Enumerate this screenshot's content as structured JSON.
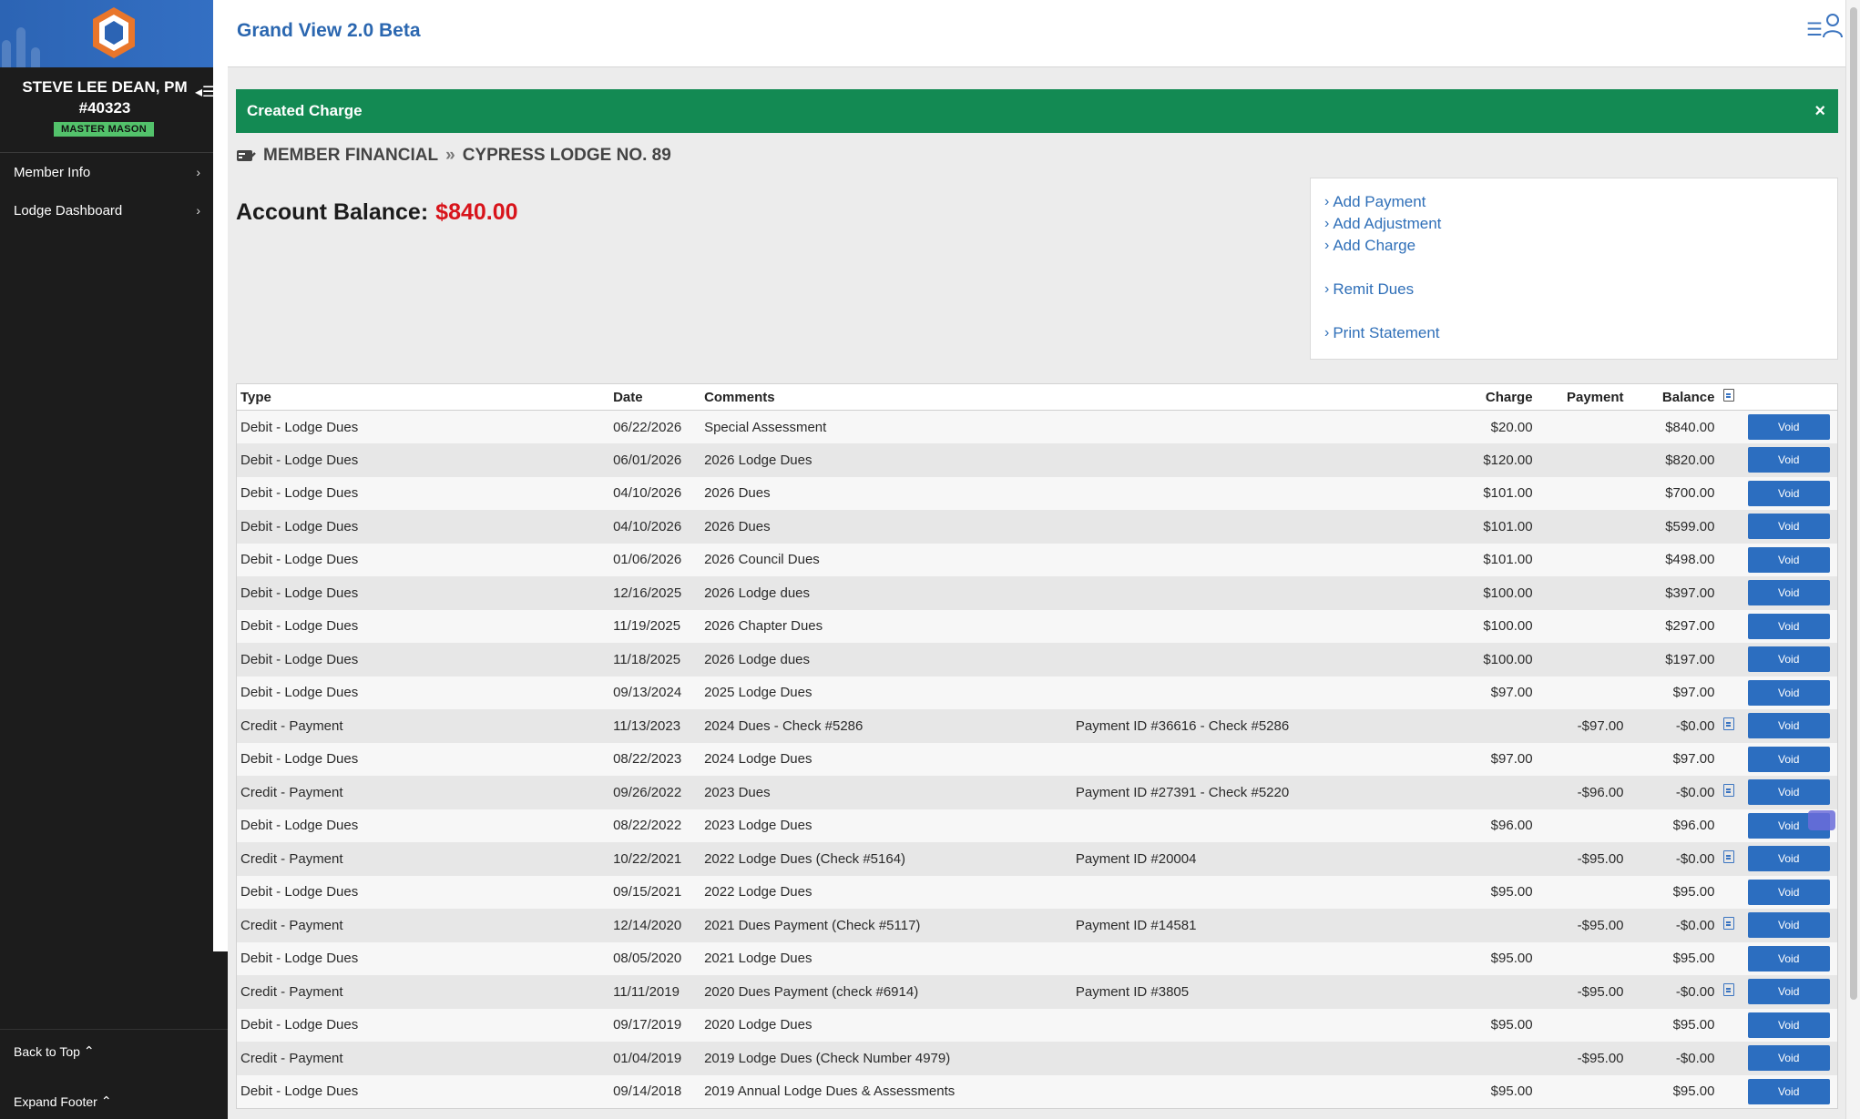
{
  "app": {
    "title": "Grand View 2.0 Beta"
  },
  "member": {
    "name": "STEVE LEE DEAN, PM",
    "number": "#40323",
    "rank": "MASTER MASON"
  },
  "sidebar": {
    "items": [
      {
        "label": "Member Info"
      },
      {
        "label": "Lodge Dashboard"
      }
    ],
    "back_to_top": "Back to Top",
    "expand_footer": "Expand Footer"
  },
  "alert": {
    "message": "Created Charge",
    "close": "×"
  },
  "breadcrumb": {
    "section": "MEMBER FINANCIAL",
    "separator": "»",
    "lodge": "CYPRESS LODGE NO. 89"
  },
  "balance": {
    "label": "Account Balance:",
    "value": "$840.00"
  },
  "actions": [
    {
      "label": "Add Payment"
    },
    {
      "label": "Add Adjustment"
    },
    {
      "label": "Add Charge"
    },
    {
      "label": "Remit Dues"
    },
    {
      "label": "Print Statement"
    }
  ],
  "table": {
    "headers": {
      "type": "Type",
      "date": "Date",
      "comments": "Comments",
      "charge": "Charge",
      "payment": "Payment",
      "balance": "Balance"
    },
    "void_label": "Void",
    "rows": [
      {
        "type": "Debit - Lodge Dues",
        "date": "06/22/2026",
        "comment": "Special Assessment",
        "note": "",
        "charge": "$20.00",
        "payment": "",
        "balance": "$840.00",
        "doc": false
      },
      {
        "type": "Debit - Lodge Dues",
        "date": "06/01/2026",
        "comment": "2026 Lodge Dues",
        "note": "",
        "charge": "$120.00",
        "payment": "",
        "balance": "$820.00",
        "doc": false
      },
      {
        "type": "Debit - Lodge Dues",
        "date": "04/10/2026",
        "comment": "2026 Dues",
        "note": "",
        "charge": "$101.00",
        "payment": "",
        "balance": "$700.00",
        "doc": false
      },
      {
        "type": "Debit - Lodge Dues",
        "date": "04/10/2026",
        "comment": "2026 Dues",
        "note": "",
        "charge": "$101.00",
        "payment": "",
        "balance": "$599.00",
        "doc": false
      },
      {
        "type": "Debit - Lodge Dues",
        "date": "01/06/2026",
        "comment": "2026 Council Dues",
        "note": "",
        "charge": "$101.00",
        "payment": "",
        "balance": "$498.00",
        "doc": false
      },
      {
        "type": "Debit - Lodge Dues",
        "date": "12/16/2025",
        "comment": "2026 Lodge dues",
        "note": "",
        "charge": "$100.00",
        "payment": "",
        "balance": "$397.00",
        "doc": false
      },
      {
        "type": "Debit - Lodge Dues",
        "date": "11/19/2025",
        "comment": "2026 Chapter Dues",
        "note": "",
        "charge": "$100.00",
        "payment": "",
        "balance": "$297.00",
        "doc": false
      },
      {
        "type": "Debit - Lodge Dues",
        "date": "11/18/2025",
        "comment": "2026 Lodge dues",
        "note": "",
        "charge": "$100.00",
        "payment": "",
        "balance": "$197.00",
        "doc": false
      },
      {
        "type": "Debit - Lodge Dues",
        "date": "09/13/2024",
        "comment": "2025 Lodge Dues",
        "note": "",
        "charge": "$97.00",
        "payment": "",
        "balance": "$97.00",
        "doc": false
      },
      {
        "type": "Credit - Payment",
        "date": "11/13/2023",
        "comment": "2024 Dues - Check #5286",
        "note": "Payment ID #36616 - Check #5286",
        "charge": "",
        "payment": "-$97.00",
        "balance": "-$0.00",
        "doc": true
      },
      {
        "type": "Debit - Lodge Dues",
        "date": "08/22/2023",
        "comment": "2024 Lodge Dues",
        "note": "",
        "charge": "$97.00",
        "payment": "",
        "balance": "$97.00",
        "doc": false
      },
      {
        "type": "Credit - Payment",
        "date": "09/26/2022",
        "comment": "2023 Dues",
        "note": "Payment ID #27391 - Check #5220",
        "charge": "",
        "payment": "-$96.00",
        "balance": "-$0.00",
        "doc": true
      },
      {
        "type": "Debit - Lodge Dues",
        "date": "08/22/2022",
        "comment": "2023 Lodge Dues",
        "note": "",
        "charge": "$96.00",
        "payment": "",
        "balance": "$96.00",
        "doc": false
      },
      {
        "type": "Credit - Payment",
        "date": "10/22/2021",
        "comment": "2022 Lodge Dues (Check #5164)",
        "note": "Payment ID #20004",
        "charge": "",
        "payment": "-$95.00",
        "balance": "-$0.00",
        "doc": true
      },
      {
        "type": "Debit - Lodge Dues",
        "date": "09/15/2021",
        "comment": "2022 Lodge Dues",
        "note": "",
        "charge": "$95.00",
        "payment": "",
        "balance": "$95.00",
        "doc": false
      },
      {
        "type": "Credit - Payment",
        "date": "12/14/2020",
        "comment": "2021 Dues Payment (Check #5117)",
        "note": "Payment ID #14581",
        "charge": "",
        "payment": "-$95.00",
        "balance": "-$0.00",
        "doc": true
      },
      {
        "type": "Debit - Lodge Dues",
        "date": "08/05/2020",
        "comment": "2021 Lodge Dues",
        "note": "",
        "charge": "$95.00",
        "payment": "",
        "balance": "$95.00",
        "doc": false
      },
      {
        "type": "Credit - Payment",
        "date": "11/11/2019",
        "comment": "2020 Dues Payment (check #6914)",
        "note": "Payment ID #3805",
        "charge": "",
        "payment": "-$95.00",
        "balance": "-$0.00",
        "doc": true
      },
      {
        "type": "Debit - Lodge Dues",
        "date": "09/17/2019",
        "comment": "2020 Lodge Dues",
        "note": "",
        "charge": "$95.00",
        "payment": "",
        "balance": "$95.00",
        "doc": false
      },
      {
        "type": "Credit - Payment",
        "date": "01/04/2019",
        "comment": "2019 Lodge Dues (Check Number 4979)",
        "note": "",
        "charge": "",
        "payment": "-$95.00",
        "balance": "-$0.00",
        "doc": false
      },
      {
        "type": "Debit - Lodge Dues",
        "date": "09/14/2018",
        "comment": "2019 Annual Lodge Dues & Assessments",
        "note": "",
        "charge": "$95.00",
        "payment": "",
        "balance": "$95.00",
        "doc": false
      }
    ]
  },
  "colors": {
    "brand": "#2b67b0",
    "alert": "#138a53",
    "balance": "#d8141b",
    "button": "#2c6ec0",
    "sidebar": "#1c1c1c"
  }
}
